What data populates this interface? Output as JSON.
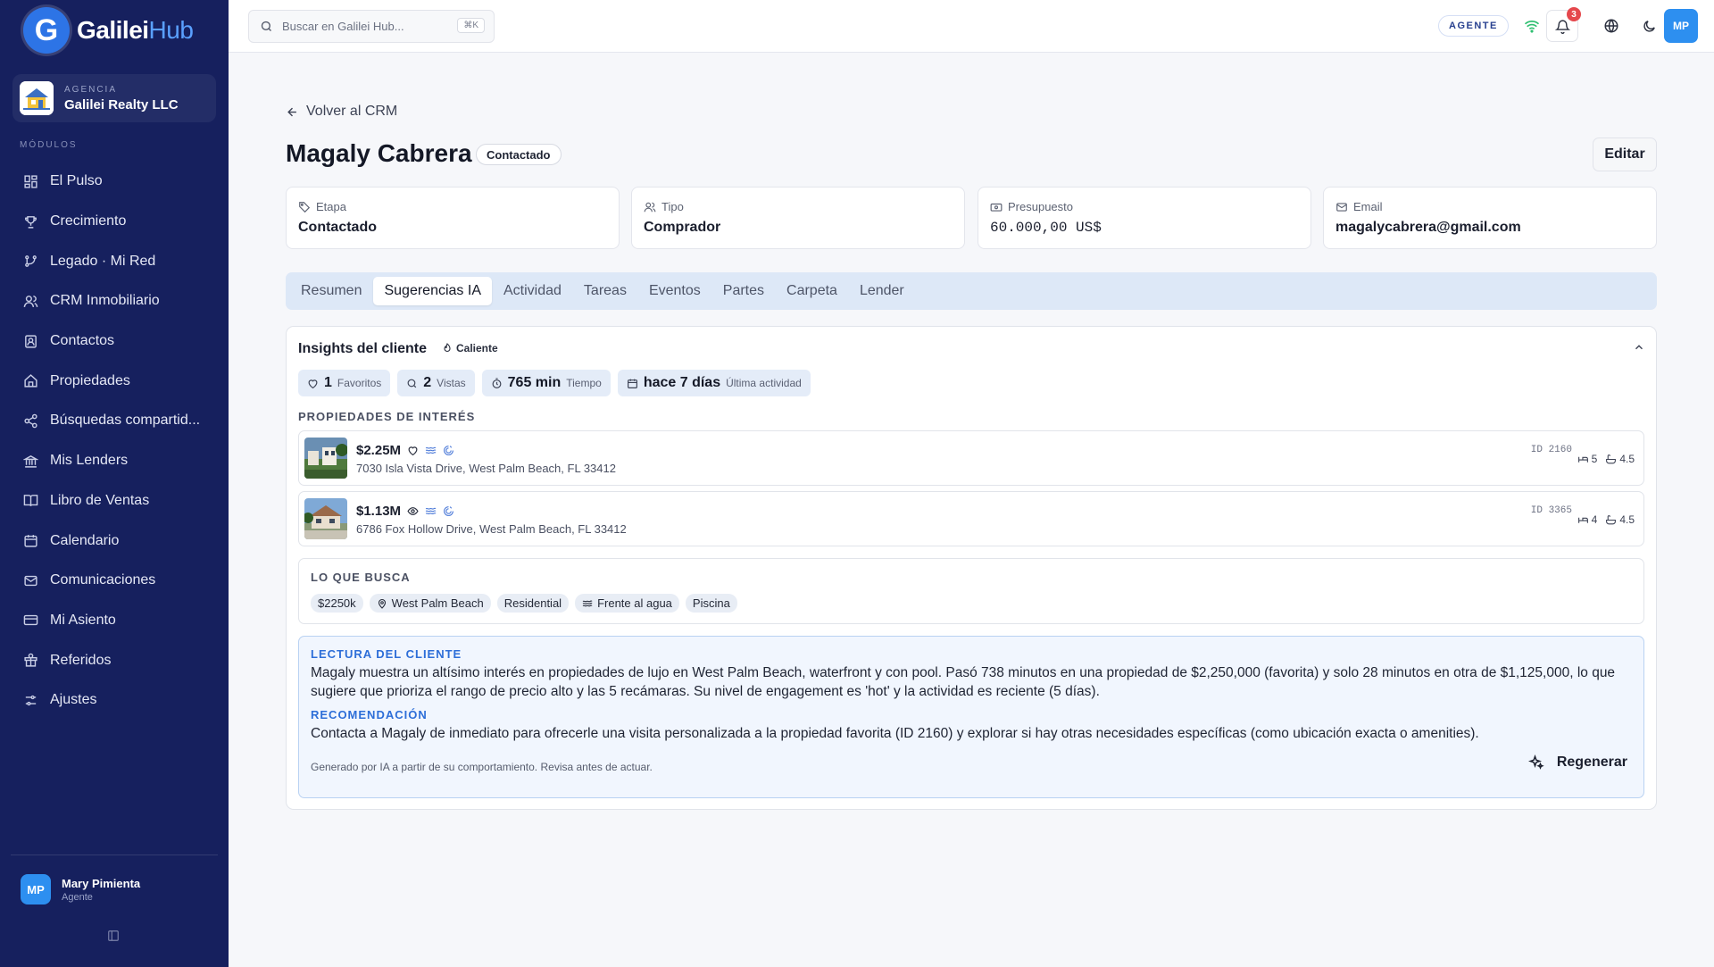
{
  "brand": {
    "name_a": "Galilei",
    "name_b": "Hub",
    "mark": "G"
  },
  "agency": {
    "caption": "AGENCIA",
    "name": "Galilei Realty LLC"
  },
  "sidebar": {
    "section_label": "MÓDULOS",
    "items": [
      {
        "label": "El Pulso",
        "icon": "dashboard-icon"
      },
      {
        "label": "Crecimiento",
        "icon": "trophy-icon"
      },
      {
        "label": "Legado · Mi Red",
        "icon": "branch-icon"
      },
      {
        "label": "CRM Inmobiliario",
        "icon": "users-icon"
      },
      {
        "label": "Contactos",
        "icon": "contact-book-icon"
      },
      {
        "label": "Propiedades",
        "icon": "home-icon"
      },
      {
        "label": "Búsquedas compartid...",
        "icon": "share-icon"
      },
      {
        "label": "Mis Lenders",
        "icon": "bank-icon"
      },
      {
        "label": "Libro de Ventas",
        "icon": "book-icon"
      },
      {
        "label": "Calendario",
        "icon": "calendar-icon"
      },
      {
        "label": "Comunicaciones",
        "icon": "mail-icon"
      },
      {
        "label": "Mi Asiento",
        "icon": "credit-card-icon"
      },
      {
        "label": "Referidos",
        "icon": "gift-icon"
      },
      {
        "label": "Ajustes",
        "icon": "sliders-icon"
      }
    ]
  },
  "user": {
    "initials": "MP",
    "name": "Mary Pimienta",
    "role": "Agente"
  },
  "topbar": {
    "search_placeholder": "Buscar en Galilei Hub...",
    "shortcut": "⌘K",
    "role_badge": "AGENTE",
    "notifications": "3",
    "avatar_initials": "MP"
  },
  "page": {
    "back_label": "Volver al CRM",
    "title": "Magaly Cabrera",
    "status": "Contactado",
    "edit_label": "Editar"
  },
  "kpis": [
    {
      "label": "Etapa",
      "value": "Contactado",
      "icon": "tag-icon"
    },
    {
      "label": "Tipo",
      "value": "Comprador",
      "icon": "users-icon"
    },
    {
      "label": "Presupuesto",
      "value": "60.000,00 US$",
      "icon": "wallet-icon"
    },
    {
      "label": "Email",
      "value": "magalycabrera@gmail.com",
      "icon": "mail-icon"
    }
  ],
  "tabs": [
    "Resumen",
    "Sugerencias IA",
    "Actividad",
    "Tareas",
    "Eventos",
    "Partes",
    "Carpeta",
    "Lender"
  ],
  "active_tab": "Sugerencias IA",
  "insights": {
    "title": "Insights del cliente",
    "temperature": "Caliente",
    "stats": [
      {
        "value": "1",
        "label": "Favoritos",
        "icon": "heart-icon"
      },
      {
        "value": "2",
        "label": "Vistas",
        "icon": "search-icon"
      },
      {
        "value": "765 min",
        "label": "Tiempo",
        "icon": "timer-icon"
      },
      {
        "value": "hace 7 días",
        "label": "Última actividad",
        "icon": "calendar-icon"
      }
    ],
    "properties_caption": "PROPIEDADES DE INTERÉS",
    "properties": [
      {
        "price": "$2.25M",
        "address": "7030 Isla Vista Drive, West Palm Beach, FL 33412",
        "id": "ID 2160",
        "beds": "5",
        "baths": "4.5",
        "status_icon": "heart-icon"
      },
      {
        "price": "$1.13M",
        "address": "6786 Fox Hollow Drive, West Palm Beach, FL 33412",
        "id": "ID 3365",
        "beds": "4",
        "baths": "4.5",
        "status_icon": "eye-icon"
      }
    ],
    "seeks_caption": "LO QUE BUSCA",
    "seeks": [
      {
        "label": "$2250k",
        "icon": ""
      },
      {
        "label": "West Palm Beach",
        "icon": "map-pin-icon"
      },
      {
        "label": "Residential",
        "icon": ""
      },
      {
        "label": "Frente al agua",
        "icon": "waves-icon"
      },
      {
        "label": "Piscina",
        "icon": ""
      }
    ],
    "reading_caption": "LECTURA DEL CLIENTE",
    "reading_text": "Magaly muestra un altísimo interés en propiedades de lujo en West Palm Beach, waterfront y con pool. Pasó 738 minutos en una propiedad de $2,250,000 (favorita) y solo 28 minutos en otra de $1,125,000, lo que sugiere que prioriza el rango de precio alto y las 5 recámaras. Su nivel de engagement es 'hot' y la actividad es reciente (5 días).",
    "recommendation_caption": "RECOMENDACIÓN",
    "recommendation_text": "Contacta a Magaly de inmediato para ofrecerle una visita personalizada a la propiedad favorita (ID 2160) y explorar si hay otras necesidades específicas (como ubicación exacta o amenities).",
    "footnote": "Generado por IA a partir de su comportamiento. Revisa antes de actuar.",
    "regenerate_label": "Regenerar"
  }
}
